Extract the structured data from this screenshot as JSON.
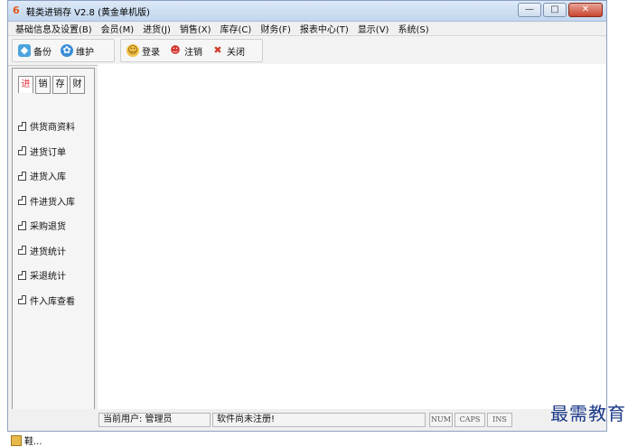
{
  "window": {
    "title": "鞋类进销存 V2.8 (黄金单机版)",
    "app_icon_glyph": "6",
    "controls": {
      "minimize": "—",
      "maximize": "□",
      "close": "✕"
    }
  },
  "menu": [
    "基础信息及设置(B)",
    "会员(M)",
    "进货(J)",
    "销售(X)",
    "库存(C)",
    "财务(F)",
    "报表中心(T)",
    "显示(V)",
    "系统(S)"
  ],
  "toolbar": {
    "group1": [
      {
        "label": "备份",
        "icon": "backup-icon"
      },
      {
        "label": "维护",
        "icon": "maintain-icon"
      }
    ],
    "group2": [
      {
        "label": "登录",
        "icon": "login-icon"
      },
      {
        "label": "注销",
        "icon": "logout-icon"
      },
      {
        "label": "关闭",
        "icon": "close-icon"
      }
    ]
  },
  "sidebar": {
    "tabs": [
      "进",
      "销",
      "存",
      "财"
    ],
    "active_tab": "进",
    "items": [
      "供货商资料",
      "进货订单",
      "进货入库",
      "件进货入库",
      "采购退货",
      "进货统计",
      "采退统计",
      "件入库查看"
    ]
  },
  "status": {
    "user": "当前用户: 管理员",
    "registration": "软件尚未注册!",
    "num": "NUM",
    "caps": "CAPS",
    "ins": "INS"
  },
  "watermark": "最需教育",
  "taskbar": {
    "label": "鞋...",
    "icon": "app-icon"
  },
  "colors": {
    "accent_tab": "#e0303a",
    "titlebar": "#c3d6ee",
    "close_button": "#c9452f"
  }
}
